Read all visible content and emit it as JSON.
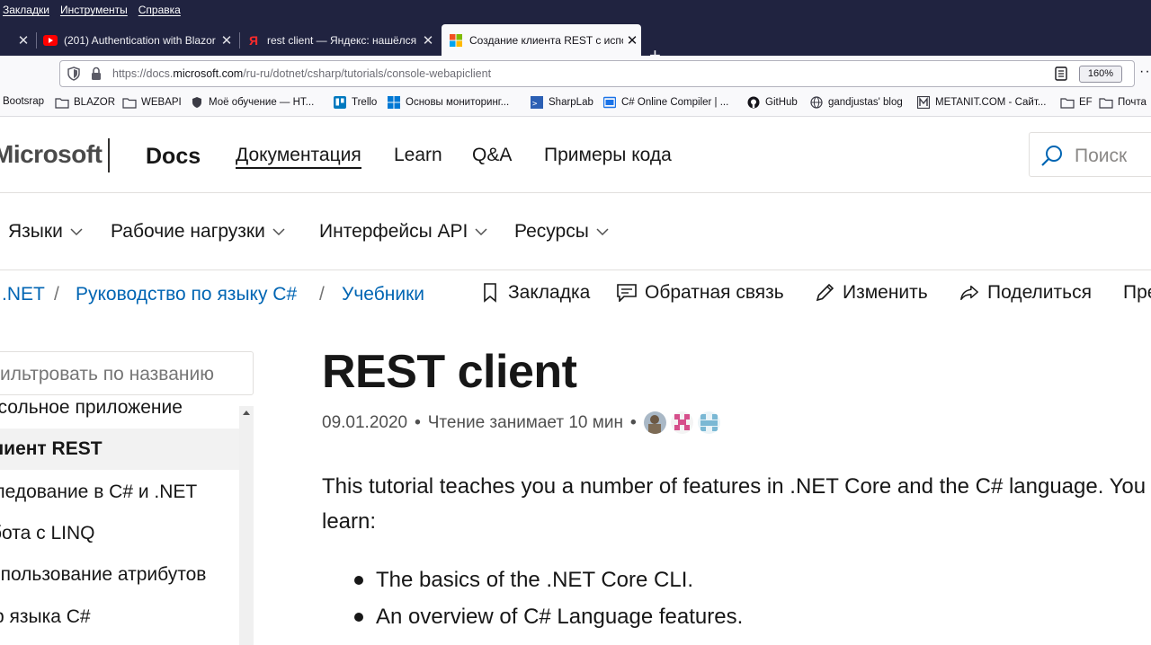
{
  "menubar": {
    "items": [
      "Закладки",
      "Инструменты",
      "Справка"
    ]
  },
  "tabs": [
    {
      "title": "",
      "active": false
    },
    {
      "title": "(201) Authentication with Blazor",
      "active": false
    },
    {
      "title": "rest client — Яндекс: нашёлся",
      "active": false
    },
    {
      "title": "Создание клиента REST с испо",
      "active": true
    }
  ],
  "navbar": {
    "url_prefix": "https://docs.",
    "url_domain": "microsoft.com",
    "url_path": "/ru-ru/dotnet/csharp/tutorials/console-webapiclient",
    "zoom": "160%"
  },
  "bookmarks": [
    "Bootsrap",
    "BLAZOR",
    "WEBAPI",
    "Моё обучение — НТ...",
    "Trello",
    "Основы мониторинг...",
    "SharpLab",
    "C# Online Compiler | ...",
    "GitHub",
    "gandjustas' blog",
    "METANIT.COM - Сайт...",
    "EF",
    "Почта"
  ],
  "header": {
    "logo": "Microsoft",
    "docs": "Docs",
    "nav": [
      "Документация",
      "Learn",
      "Q&A",
      "Примеры кода"
    ],
    "search_placeholder": "Поиск"
  },
  "subnav": [
    "Языки",
    "Рабочие нагрузки",
    "Интерфейсы API",
    "Ресурсы"
  ],
  "breadcrumb": [
    ".NET",
    "Руководство по языку C#",
    "Учебники"
  ],
  "actions": [
    "Закладка",
    "Обратная связь",
    "Изменить",
    "Поделиться",
    "Пре"
  ],
  "toc": {
    "filter_placeholder": "Фильтровать по названию",
    "items": [
      "Консольное приложение",
      "Клиент REST",
      "Наследование в C# и .NET",
      "Работа с LINQ",
      "Использование атрибутов",
      "Обзор языка C#"
    ],
    "selected_index": 1
  },
  "article": {
    "title": "REST client",
    "date": "09.01.2020",
    "reading_time": "Чтение занимает 10 мин",
    "intro_line1": "This tutorial teaches you a number of features in .NET Core and the C# language. You",
    "intro_line2": "learn:",
    "bullets": [
      "The basics of the .NET Core CLI.",
      "An overview of C# Language features."
    ]
  },
  "colors": {
    "chrome_dark": "#202340",
    "link_blue": "#0065b3",
    "toc_selected_bg": "#f2f2f2"
  }
}
